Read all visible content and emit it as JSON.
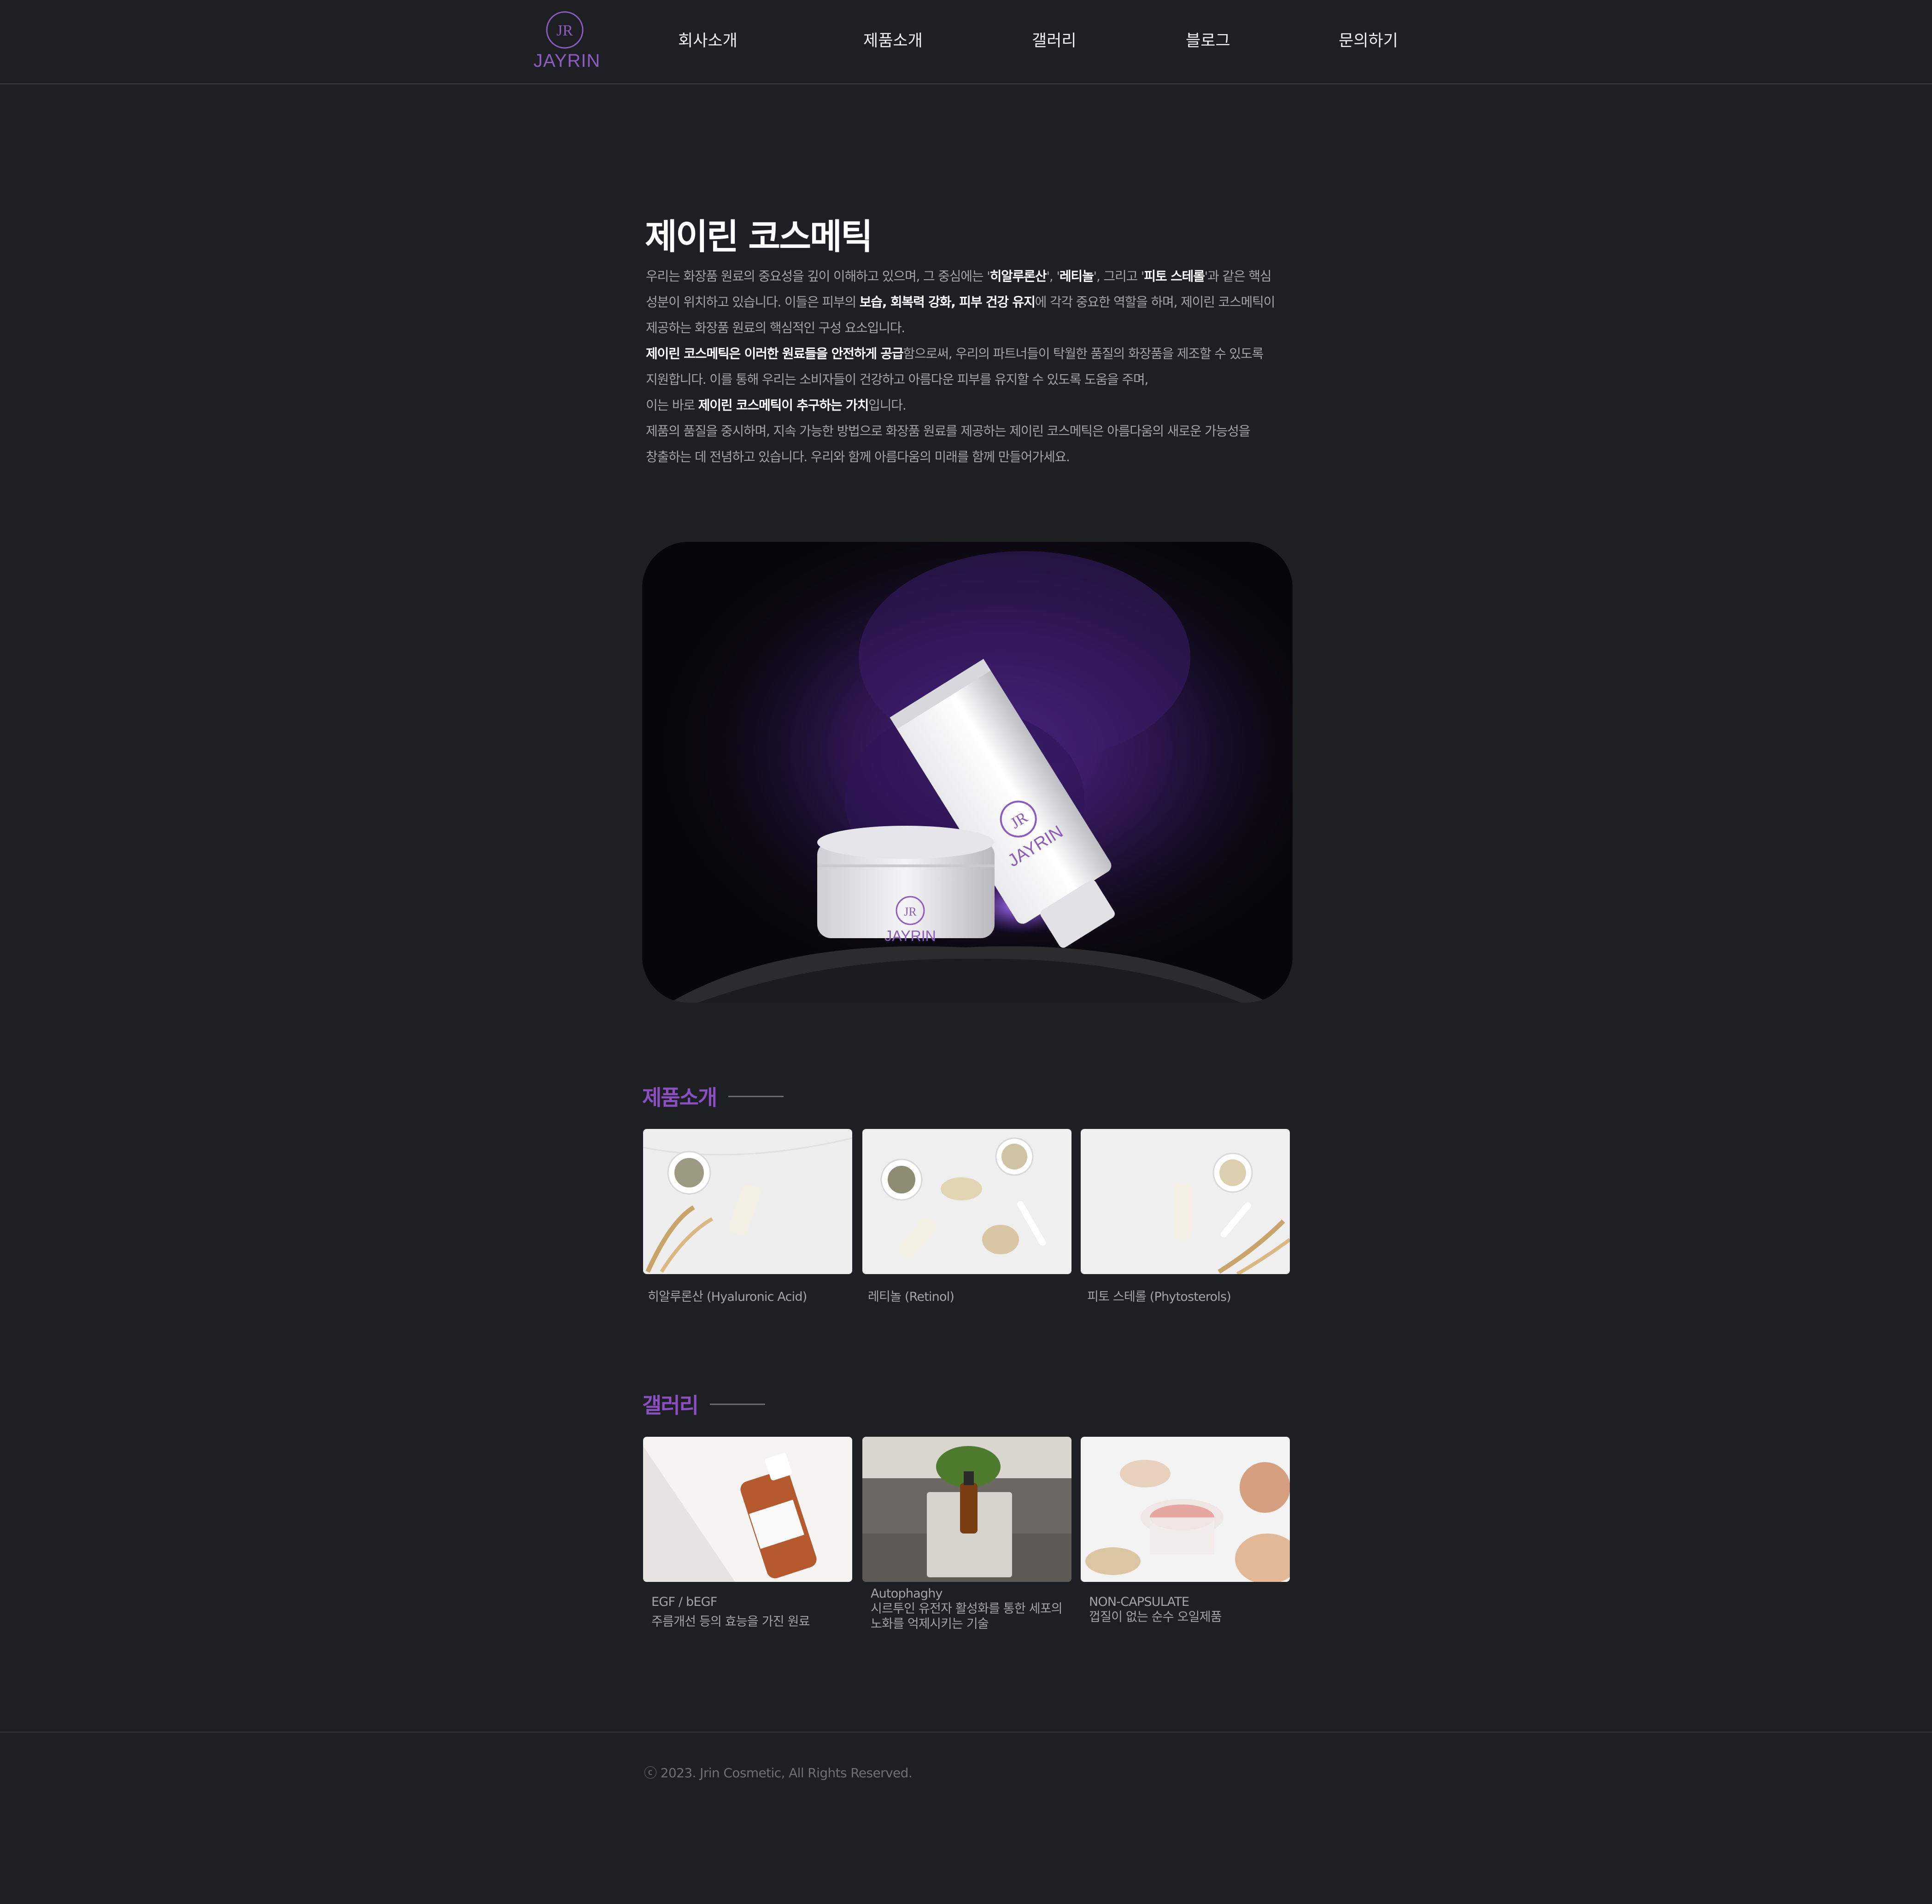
{
  "header": {
    "logo_text": "JAYRIN",
    "logo_initials": "JR",
    "nav": [
      "회사소개",
      "제품소개",
      "갤러리",
      "블로그",
      "문의하기"
    ]
  },
  "intro": {
    "title": "제이린 코스메틱",
    "lines": [
      [
        {
          "t": "우리는 화장품 원료의 중요성을 깊이 이해하고 있으며, 그 중심에는 '"
        },
        {
          "t": "히알루론산",
          "b": true
        },
        {
          "t": "', '"
        },
        {
          "t": "레티놀",
          "b": true
        },
        {
          "t": "', 그리고 '"
        },
        {
          "t": "피토 스테롤",
          "b": true
        },
        {
          "t": "'과 같은 핵심"
        }
      ],
      [
        {
          "t": "성분이 위치하고 있습니다. 이들은 피부의 "
        },
        {
          "t": "보습, 회복력 강화, 피부 건강 유지",
          "b": true
        },
        {
          "t": "에 각각 중요한 역할을 하며, 제이린 코스메틱이"
        }
      ],
      [
        {
          "t": "제공하는 화장품 원료의 핵심적인 구성 요소입니다."
        }
      ],
      [
        {
          "t": "제이린 코스메틱은 이러한 원료들을 안전하게 공급",
          "b": true
        },
        {
          "t": "함으로써, 우리의 파트너들이 탁월한 품질의 화장품을 제조할 수 있도록"
        }
      ],
      [
        {
          "t": "지원합니다. 이를 통해 우리는 소비자들이 건강하고 아름다운 피부를 유지할 수 있도록 도움을 주며,"
        }
      ],
      [
        {
          "t": "이는 바로 "
        },
        {
          "t": "제이린 코스메틱이 추구하는 가치",
          "b": true
        },
        {
          "t": "입니다."
        }
      ],
      [
        {
          "t": "제품의 품질을 중시하며, 지속 가능한 방법으로 화장품 원료를 제공하는 제이린 코스메틱은 아름다움의 새로운 가능성을"
        }
      ],
      [
        {
          "t": "창출하는 데 전념하고 있습니다. 우리와 함께 아름다움의 미래를 함께 만들어가세요."
        }
      ]
    ]
  },
  "hero": {
    "tube_brand": "JAYRIN",
    "jar_brand": "JAYRIN"
  },
  "products": {
    "title": "제품소개",
    "items": [
      {
        "caption": "히알루론산 (Hyaluronic Acid)"
      },
      {
        "caption": "레티놀 (Retinol)"
      },
      {
        "caption": "피토 스테롤 (Phytosterols)"
      }
    ]
  },
  "gallery": {
    "title": "갤러리",
    "items": [
      {
        "title": "EGF / bEGF",
        "lines": [
          "주름개선 등의 효능을 가진 원료"
        ]
      },
      {
        "title": "Autophaghy",
        "lines": [
          "시르투인 유전자 활성화를 통한 세포의",
          "노화를 억제시키는 기술"
        ]
      },
      {
        "title": "NON-CAPSULATE",
        "lines": [
          "껍질이 없는 순수 오일제품"
        ]
      }
    ]
  },
  "footer": {
    "copyright": "ⓒ 2023. Jrin Cosmetic, All Rights Reserved."
  },
  "colors": {
    "background": "#1e1f23",
    "accent": "#8a4fc0",
    "text": "#a3a3a8",
    "heading": "#ffffff"
  }
}
